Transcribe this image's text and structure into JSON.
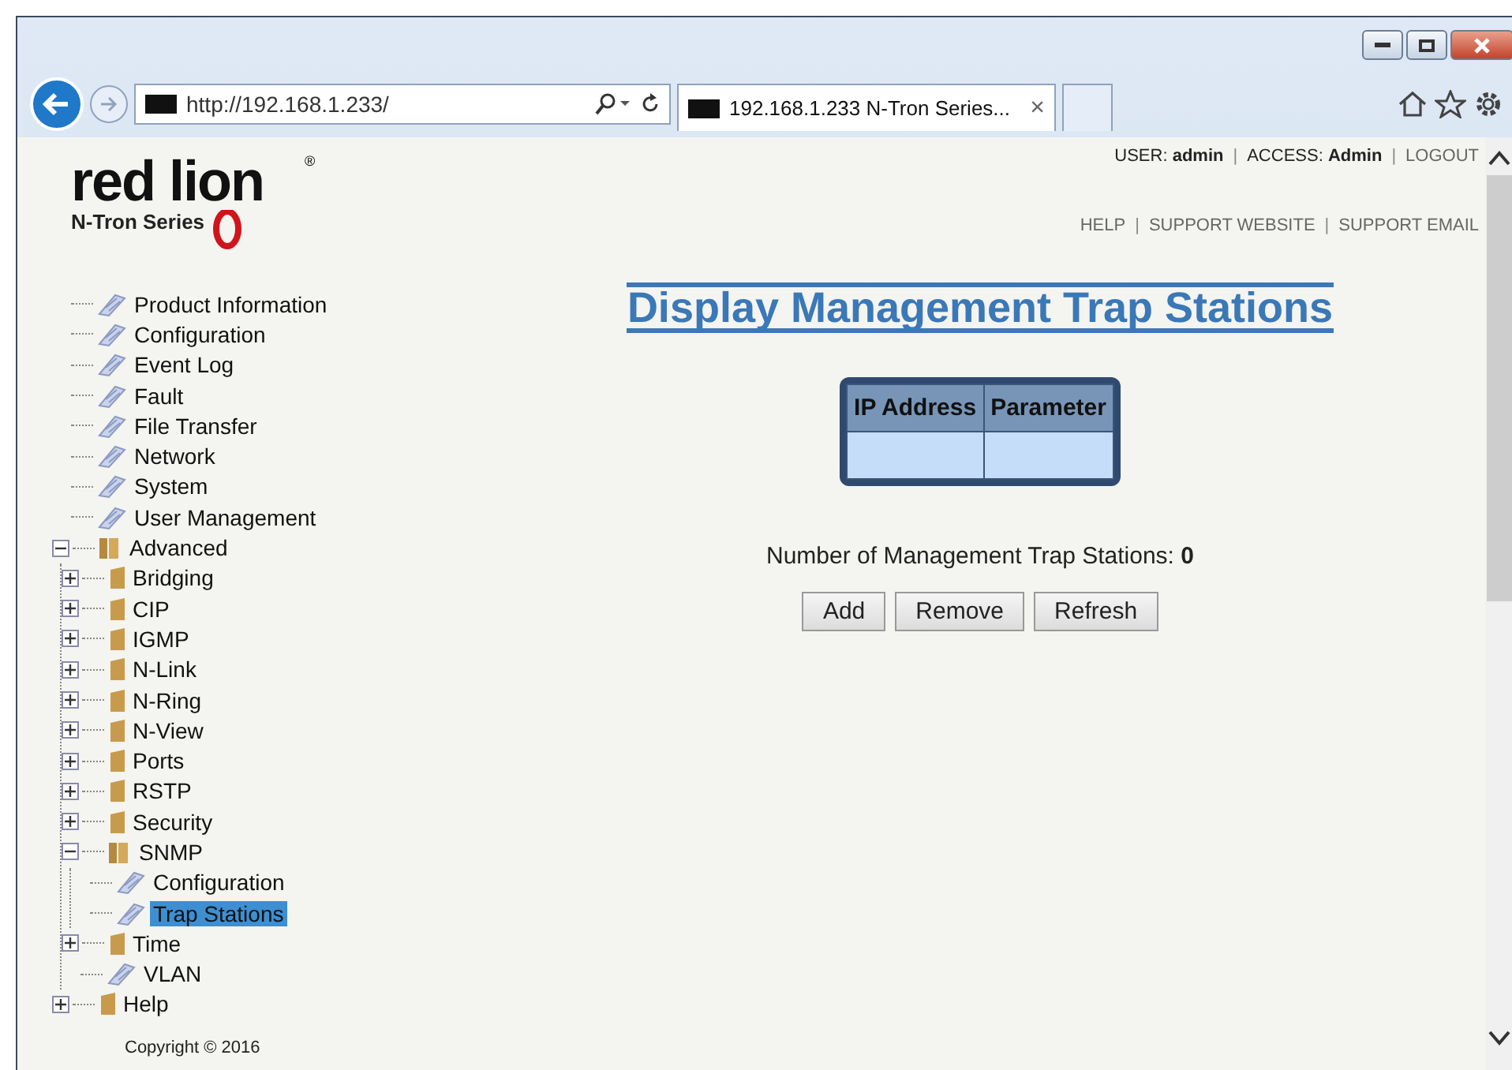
{
  "browser": {
    "address": "http://192.168.1.233/",
    "tab_title": "192.168.1.233 N-Tron Series...",
    "tab_close": "×"
  },
  "logo": {
    "brand": "red lion",
    "series": "N-Tron Series",
    "mark": "®"
  },
  "header": {
    "user": "USER: **admin**",
    "access": "ACCESS: **Admin**",
    "logout": "LOGOUT",
    "help": "HELP",
    "support_website": "SUPPORT WEBSITE",
    "support_email": "SUPPORT EMAIL",
    "separator": "|"
  },
  "tree": [
    {
      "label": "Product Information",
      "kind": "page",
      "selected": false
    },
    {
      "label": "Configuration",
      "kind": "page",
      "selected": false
    },
    {
      "label": "Event Log",
      "kind": "page",
      "selected": false
    },
    {
      "label": "Fault",
      "kind": "page",
      "selected": false
    },
    {
      "label": "File Transfer",
      "kind": "page",
      "selected": false
    },
    {
      "label": "Network",
      "kind": "page",
      "selected": false
    },
    {
      "label": "System",
      "kind": "page",
      "selected": false
    },
    {
      "label": "User Management",
      "kind": "page",
      "selected": false
    },
    {
      "label": "Advanced",
      "kind": "folder",
      "selected": false,
      "expanded": true,
      "children": [
        {
          "label": "Bridging",
          "kind": "folder",
          "selected": false,
          "expanded": false
        },
        {
          "label": "CIP",
          "kind": "folder",
          "selected": false,
          "expanded": false
        },
        {
          "label": "IGMP",
          "kind": "folder",
          "selected": false,
          "expanded": false
        },
        {
          "label": "N-Link",
          "kind": "folder",
          "selected": false,
          "expanded": false
        },
        {
          "label": "N-Ring",
          "kind": "folder",
          "selected": false,
          "expanded": false
        },
        {
          "label": "N-View",
          "kind": "folder",
          "selected": false,
          "expanded": false
        },
        {
          "label": "Ports",
          "kind": "folder",
          "selected": false,
          "expanded": false
        },
        {
          "label": "RSTP",
          "kind": "folder",
          "selected": false,
          "expanded": false
        },
        {
          "label": "Security",
          "kind": "folder",
          "selected": false,
          "expanded": false
        },
        {
          "label": "SNMP",
          "kind": "folder",
          "selected": false,
          "expanded": true,
          "children": [
            {
              "label": "Configuration",
              "kind": "page",
              "selected": false
            },
            {
              "label": "Trap Stations",
              "kind": "page",
              "selected": true
            }
          ]
        },
        {
          "label": "Time",
          "kind": "folder",
          "selected": false,
          "expanded": false
        },
        {
          "label": "VLAN",
          "kind": "page",
          "selected": false
        }
      ]
    },
    {
      "label": "Help",
      "kind": "folder",
      "selected": false,
      "expanded": false
    }
  ],
  "copyright": "Copyright © 2016",
  "title": "Display Management Trap Stations",
  "table": {
    "columns": [
      "IP Address",
      "Parameter"
    ]
  },
  "count": "Number of Management Trap Stations: **0**",
  "buttons": [
    "Add",
    "Remove",
    "Refresh"
  ]
}
